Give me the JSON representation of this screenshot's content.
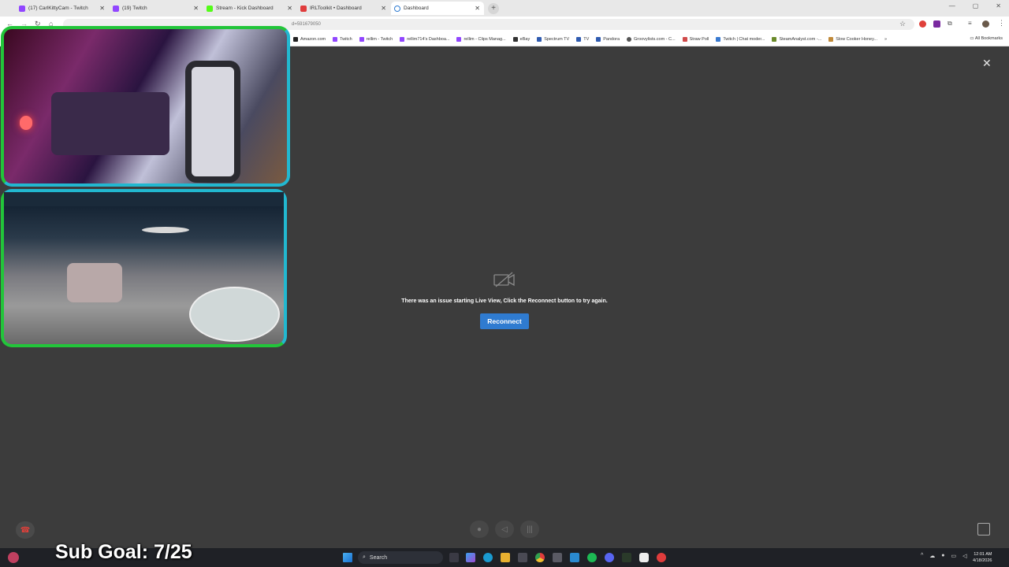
{
  "tabs": [
    {
      "title": "(17) CarlKittyCam - Twitch",
      "color": "#9146ff"
    },
    {
      "title": "(19) Twitch",
      "color": "#9146ff"
    },
    {
      "title": "Stream - Kick Dashboard",
      "color": "#53fc18"
    },
    {
      "title": "IRLToolkit • Dashboard",
      "color": "#e03c3c"
    },
    {
      "title": "Dashboard",
      "color": "#2f7bd0",
      "active": true
    }
  ],
  "address": {
    "url": "d=591679050"
  },
  "bookmarks": [
    {
      "label": "Amazon.com"
    },
    {
      "label": "Twitch"
    },
    {
      "label": "rellim - Twitch"
    },
    {
      "label": "rellim714's Dashboa..."
    },
    {
      "label": "rellim - Clips Manag..."
    },
    {
      "label": "eBay"
    },
    {
      "label": "Spectrum TV"
    },
    {
      "label": "TV"
    },
    {
      "label": "Pandora"
    },
    {
      "label": "Groovylists.com - C..."
    },
    {
      "label": "Straw Poll"
    },
    {
      "label": "Twitch | Chat moder..."
    },
    {
      "label": "SteamAnalyst.com -..."
    },
    {
      "label": "Slow Cooker Honey..."
    }
  ],
  "all_bookmarks": "All Bookmarks",
  "liveview": {
    "error_message": "There was an issue starting Live View, Click the Reconnect button to try again.",
    "reconnect_label": "Reconnect"
  },
  "overlay": {
    "sub_goal": "Sub Goal: 7/25"
  },
  "taskbar": {
    "search_label": "Search",
    "time": "12:01 AM",
    "date": "4/18/2026"
  },
  "colors": {
    "accent": "#2f7bd0",
    "background": "#3c3c3c",
    "hangup": "#e0403a"
  }
}
